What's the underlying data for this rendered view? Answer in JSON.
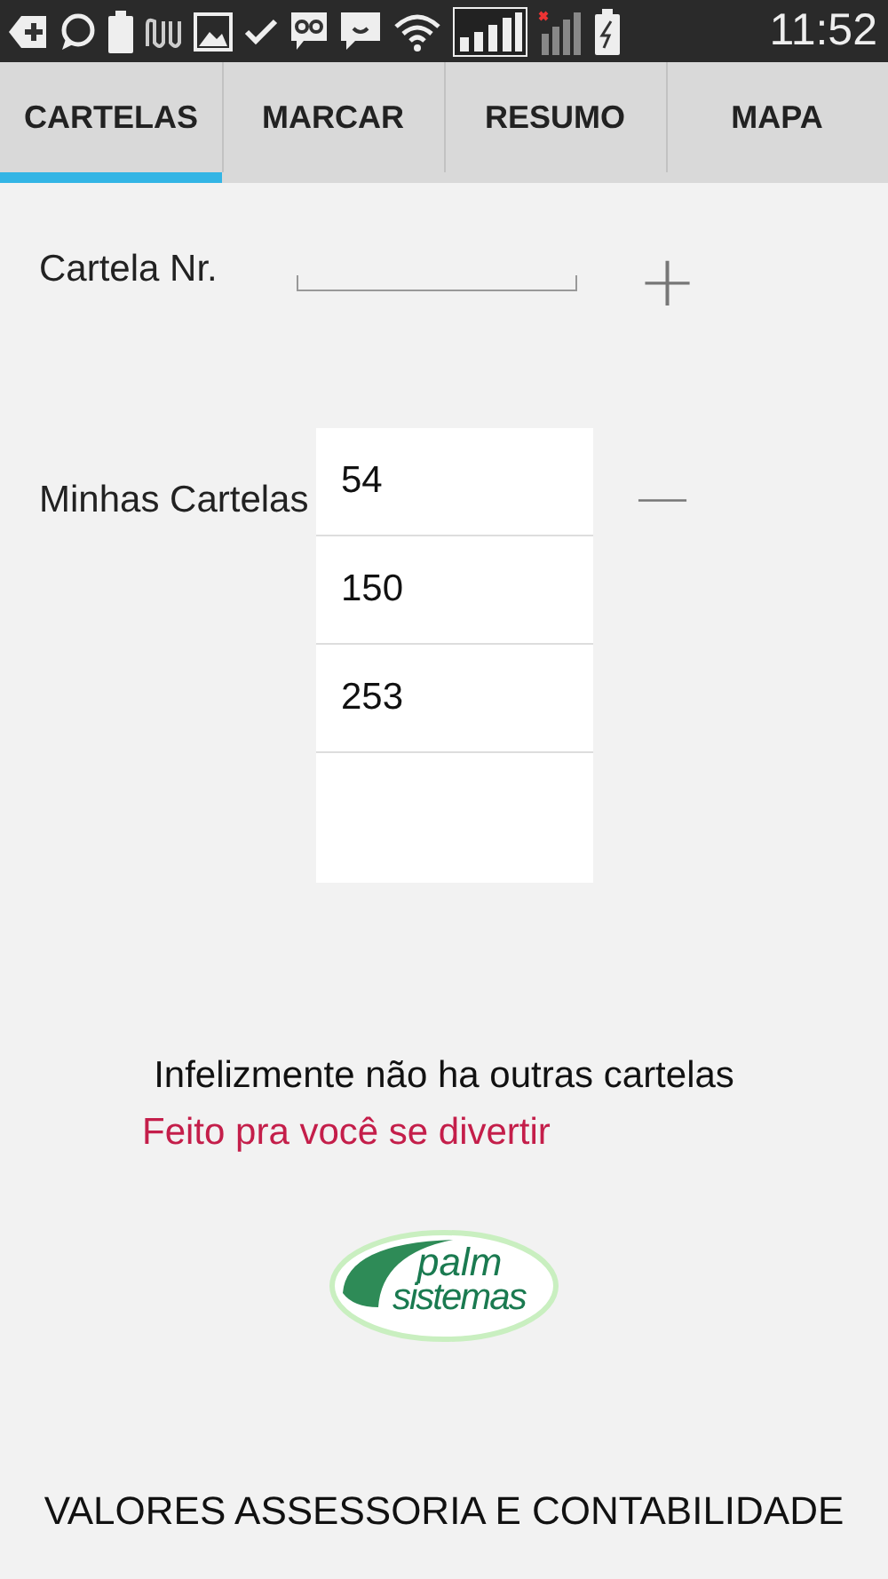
{
  "status_bar": {
    "time": "11:52"
  },
  "tabs": [
    {
      "label": "CARTELAS",
      "selected": true
    },
    {
      "label": "MARCAR",
      "selected": false
    },
    {
      "label": "RESUMO",
      "selected": false
    },
    {
      "label": "MAPA",
      "selected": false
    }
  ],
  "card_entry": {
    "label": "Cartela Nr.",
    "add_symbol": "+"
  },
  "my_cards": {
    "label": "Minhas Cartelas",
    "remove_symbol": "—",
    "items": [
      "54",
      "150",
      "253"
    ]
  },
  "message": "Infelizmente não ha outras cartelas",
  "tagline": "Feito pra você se divertir",
  "logo": {
    "line_1": "palm",
    "line_2": "sistemas"
  },
  "footer": "VALORES ASSESSORIA E CONTABILIDADE"
}
